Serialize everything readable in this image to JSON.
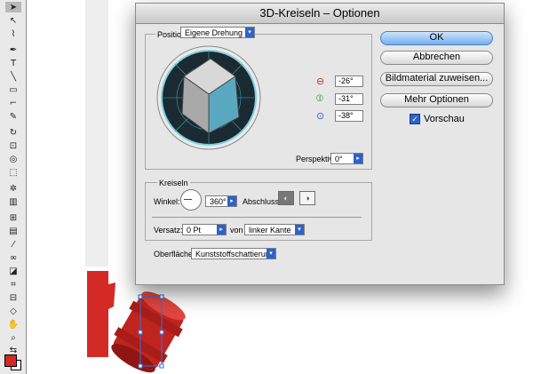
{
  "dialog": {
    "title": "3D-Kreiseln – Optionen"
  },
  "position": {
    "group_label": "Position",
    "preset": "Eigene Drehung",
    "rotation_x": "-26°",
    "rotation_y": "-31°",
    "rotation_z": "-38°",
    "perspective_label": "Perspektive:",
    "perspective": "0°"
  },
  "kreiseln": {
    "group_label": "Kreiseln",
    "winkel_label": "Winkel:",
    "winkel": "360°",
    "abschluss_label": "Abschluss:",
    "versatz_label": "Versatz:",
    "versatz": "0 Pt",
    "von_label": "von",
    "von": "linker Kante"
  },
  "oberflaeche": {
    "label": "Oberfläche:",
    "value": "Kunststoffschattierung"
  },
  "buttons": {
    "ok": "OK",
    "cancel": "Abbrechen",
    "map_art": "Bildmaterial zuweisen...",
    "more": "Mehr Optionen"
  },
  "preview": {
    "label": "Vorschau",
    "checked": true
  },
  "colors": {
    "accent": "#2d63c9",
    "cube_front": "#5aa8c0",
    "art_red": "#d42a25"
  },
  "tools": [
    "selection-tool",
    "direct-selection-tool",
    "group-selection-tool",
    "lasso-tool",
    "pen-tool",
    "type-tool",
    "line-tool",
    "rectangle-tool",
    "paintbrush-tool",
    "pencil-tool",
    "rotate-tool",
    "scale-tool",
    "warp-tool",
    "free-transform-tool",
    "symbol-sprayer-tool",
    "column-graph-tool",
    "mesh-tool",
    "gradient-tool",
    "eyedropper-tool",
    "blend-tool",
    "live-paint-tool",
    "live-paint-selection-tool",
    "crop-tool",
    "slice-tool",
    "eraser-tool",
    "scissors-tool",
    "hand-tool",
    "zoom-tool"
  ]
}
